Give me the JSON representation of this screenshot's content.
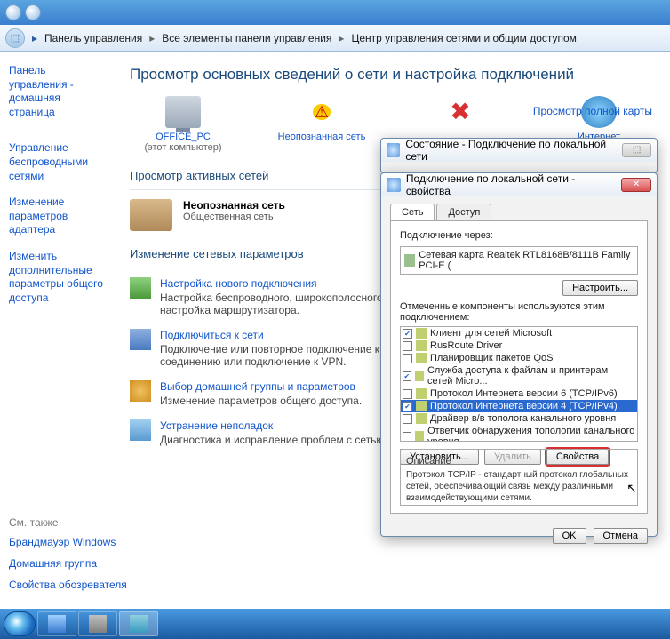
{
  "breadcrumb": {
    "items": [
      "Панель управления",
      "Все элементы панели управления",
      "Центр управления сетями и общим доступом"
    ]
  },
  "sidebar": {
    "links": [
      "Панель управления - домашняя страница",
      "Управление беспроводными сетями",
      "Изменение параметров адаптера",
      "Изменить дополнительные параметры общего доступа"
    ]
  },
  "content": {
    "heading": "Просмотр основных сведений о сети и настройка подключений",
    "view_map": "Просмотр полной карты",
    "net_items": [
      {
        "label": "OFFICE_PC",
        "sub": "(этот компьютер)"
      },
      {
        "label": "Неопознанная сеть",
        "sub": ""
      },
      {
        "label": "",
        "sub": ""
      },
      {
        "label": "Интернет",
        "sub": ""
      }
    ],
    "active_nets_title": "Просмотр активных сетей",
    "active_net": {
      "name": "Неопознанная сеть",
      "type": "Общественная сеть"
    },
    "params_title": "Изменение сетевых параметров",
    "params": [
      {
        "title": "Настройка нового подключения",
        "desc": "Настройка беспроводного, широкополосного, модемного, прямого или VPN-подключения, или же настройка маршрутизатора."
      },
      {
        "title": "Подключиться к сети",
        "desc": "Подключение или повторное подключение к беспроводному, проводному, модемному сетевому соединению или подключение к VPN."
      },
      {
        "title": "Выбор домашней группы и параметров",
        "desc": "Изменение параметров общего доступа."
      },
      {
        "title": "Устранение неполадок",
        "desc": "Диагностика и исправление проблем с сетью."
      }
    ]
  },
  "status_dialog": {
    "title": "Состояние - Подключение по локальной сети"
  },
  "props_dialog": {
    "title": "Подключение по локальной сети - свойства",
    "tabs": [
      "Сеть",
      "Доступ"
    ],
    "conn_via_label": "Подключение через:",
    "adapter": "Сетевая карта Realtek RTL8168B/8111B Family PCI-E (",
    "configure_btn": "Настроить...",
    "components_label": "Отмеченные компоненты используются этим подключением:",
    "components": [
      {
        "checked": true,
        "label": "Клиент для сетей Microsoft"
      },
      {
        "checked": false,
        "label": "RusRoute Driver"
      },
      {
        "checked": false,
        "label": "Планировщик пакетов QoS"
      },
      {
        "checked": true,
        "label": "Служба доступа к файлам и принтерам сетей Micro..."
      },
      {
        "checked": false,
        "label": "Протокол Интернета версии 6 (TCP/IPv6)"
      },
      {
        "checked": true,
        "label": "Протокол Интернета версии 4 (TCP/IPv4)",
        "selected": true
      },
      {
        "checked": false,
        "label": "Драйвер в/в тополога канального уровня"
      },
      {
        "checked": false,
        "label": "Ответчик обнаружения топологии канального уровня"
      }
    ],
    "install_btn": "Установить...",
    "remove_btn": "Удалить",
    "props_btn": "Свойства",
    "desc_hdr": "Описание",
    "desc_text": "Протокол TCP/IP - стандартный протокол глобальных сетей, обеспечивающий связь между различными взаимодействующими сетями.",
    "ok": "OK",
    "cancel": "Отмена"
  },
  "see_also": {
    "header": "См. также",
    "links": [
      "Брандмауэр Windows",
      "Домашняя группа",
      "Свойства обозревателя"
    ]
  }
}
